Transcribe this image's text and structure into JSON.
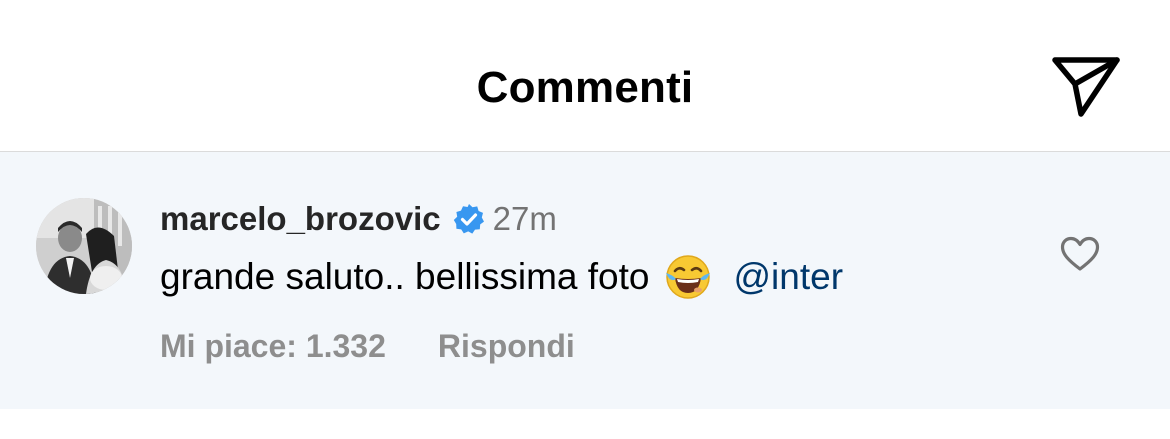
{
  "header": {
    "title": "Commenti",
    "share_icon": "paper-plane-icon"
  },
  "comment": {
    "username": "marcelo_brozovic",
    "verified": true,
    "time": "27m",
    "text": "grande saluto.. bellissima foto",
    "emoji": "face-with-tears-of-joy",
    "mention": "@inter",
    "likes_label": "Mi piace: 1.332",
    "reply_label": "Rispondi",
    "like_icon": "heart-outline-icon"
  },
  "colors": {
    "background": "#ffffff",
    "highlight_background": "#f3f7fb",
    "verified_badge": "#3897f0",
    "mention": "#00376b",
    "secondary_text": "#8e8e8e"
  }
}
